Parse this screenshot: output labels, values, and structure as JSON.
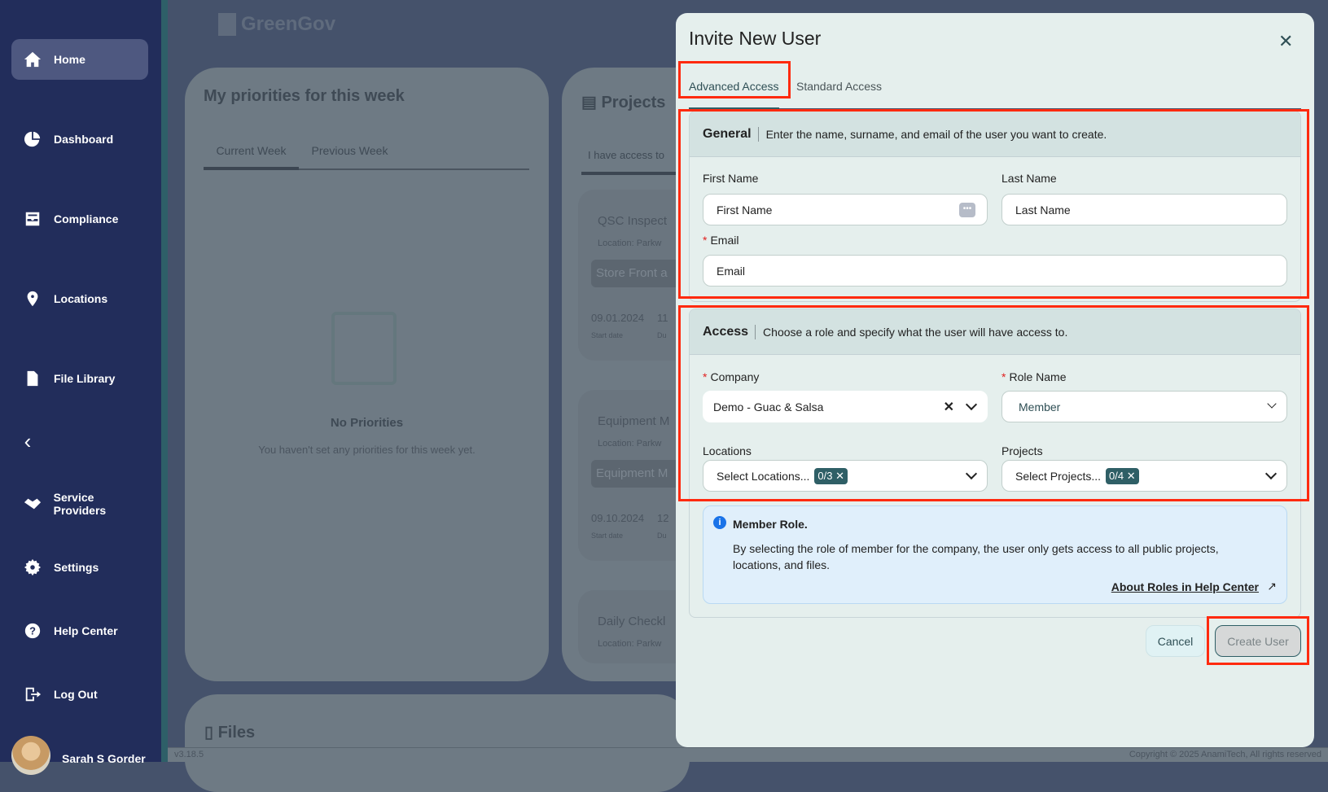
{
  "app": {
    "logo": "GreenGov",
    "version": "v3.18.5",
    "copyright": "Copyright © 2025 AnamiTech, All rights reserved"
  },
  "sidebar": {
    "items": [
      {
        "label": "Home",
        "icon": "home-icon"
      },
      {
        "label": "Dashboard",
        "icon": "pie-chart-icon"
      },
      {
        "label": "Compliance",
        "icon": "inbox-icon"
      },
      {
        "label": "Locations",
        "icon": "location-pin-icon"
      },
      {
        "label": "File Library",
        "icon": "file-icon"
      },
      {
        "label": "Service Providers",
        "icon": "handshake-icon"
      },
      {
        "label": "Settings",
        "icon": "gear-icon"
      },
      {
        "label": "Help Center",
        "icon": "help-icon"
      },
      {
        "label": "Log Out",
        "icon": "logout-icon"
      }
    ],
    "user": "Sarah S Gorder"
  },
  "priorities": {
    "title": "My priorities for this week",
    "tabs": [
      "Current Week",
      "Previous Week"
    ],
    "empty_title": "No Priorities",
    "empty_text": "You haven't set any priorities for this week yet."
  },
  "projects": {
    "title": "Projects",
    "tab": "I have access to",
    "items": [
      {
        "name": "QSC Inspect",
        "location": "Location: Parkw",
        "tag": "Store Front a",
        "start": "09.01.2024",
        "due": "11",
        "start_label": "Start date",
        "due_label": "Du"
      },
      {
        "name": "Equipment M",
        "location": "Location: Parkw",
        "tag": "Equipment M",
        "start": "09.10.2024",
        "due": "12",
        "start_label": "Start date",
        "due_label": "Du"
      },
      {
        "name": "Daily Checkl",
        "location": "Location: Parkw"
      }
    ]
  },
  "files": {
    "title": "Files"
  },
  "modal": {
    "title": "Invite New User",
    "tabs": [
      "Advanced Access",
      "Standard Access"
    ],
    "general": {
      "title": "General",
      "desc": "Enter the name, surname, and email of the user you want to create.",
      "first_label": "First Name",
      "first_placeholder": "First Name",
      "last_label": "Last Name",
      "last_placeholder": "Last Name",
      "email_label": "Email",
      "email_placeholder": "Email"
    },
    "access": {
      "title": "Access",
      "desc": "Choose a role and specify what the user will have access to.",
      "company_label": "Company",
      "company_value": "Demo - Guac & Salsa",
      "role_label": "Role Name",
      "role_value": "Member",
      "locations_label": "Locations",
      "locations_placeholder": "Select Locations...",
      "locations_count": "0/3",
      "projects_label": "Projects",
      "projects_placeholder": "Select Projects...",
      "projects_count": "0/4"
    },
    "info": {
      "title": "Member Role.",
      "text": "By selecting the role of member for the company, the user only gets access to all public projects, locations, and files.",
      "link": "About Roles in Help Center"
    },
    "cancel": "Cancel",
    "create": "Create User"
  }
}
